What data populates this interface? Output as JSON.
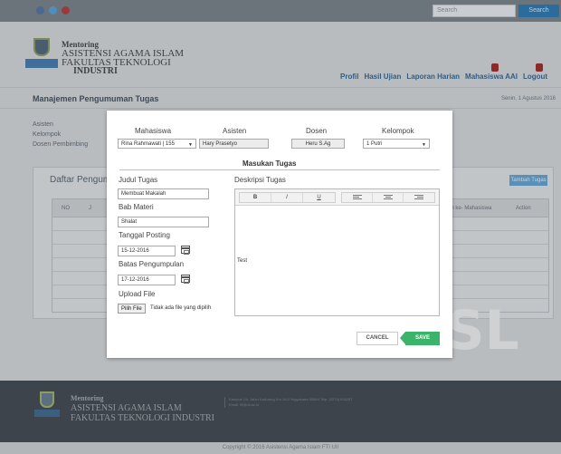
{
  "topbar": {
    "search_placeholder": "Search",
    "search_button": "Search"
  },
  "brand": {
    "line1": "Mentoring",
    "line2": "ASISTENSI AGAMA ISLAM",
    "line3": "FAKULTAS TEKNOLOGI",
    "line4": "INDUSTRI"
  },
  "nav": {
    "profil": "Profil",
    "hasil_ujian": "Hasil Ujian",
    "laporan_harian": "Laporan Harian",
    "mahasiswa_aai": "Mahasiswa AAI",
    "logout": "Logout"
  },
  "page": {
    "title": "Manajemen Pengumuman Tugas",
    "date": "Senin, 1 Agustus 2016"
  },
  "sidebar": {
    "items": [
      {
        "label": "Asisten"
      },
      {
        "label": "Kelompok"
      },
      {
        "label": "Dosen Pembimbing"
      }
    ]
  },
  "panel": {
    "title": "Daftar Pengum",
    "add_button": "Tambah Tugas",
    "columns": {
      "no": "NO",
      "col2": "J",
      "mhs": "an ke- Mahasiswa",
      "action": "Action"
    }
  },
  "modal": {
    "mahasiswa": {
      "label": "Mahasiswa",
      "value": "Rina Rahmawati | 155"
    },
    "asisten": {
      "label": "Asisten",
      "value": "Hary Prasetyo"
    },
    "dosen": {
      "label": "Dosen",
      "value": "Heru S.Ag"
    },
    "kelompok": {
      "label": "Kelompok",
      "value": "1 Putri"
    },
    "title": "Masukan Tugas",
    "judul": {
      "label": "Judul Tugas",
      "value": "Membuat Makalah"
    },
    "bab": {
      "label": "Bab Materi",
      "value": "Shalat"
    },
    "tanggal": {
      "label": "Tanggal Posting",
      "value": "15-12-2016"
    },
    "batas": {
      "label": "Batas Pengumpulan",
      "value": "17-12-2016"
    },
    "upload": {
      "label": "Upload File",
      "button": "Pilih File",
      "status": "Tidak ada file yang dipilih"
    },
    "deskripsi": {
      "label": "Deskripsi Tugas",
      "content": "Test"
    },
    "toolbar": {
      "bold": "B",
      "italic": "I",
      "underline": "U"
    },
    "cancel": "CANCEL",
    "save": "SAVE"
  },
  "footer": {
    "line1": "Mentoring",
    "line2": "ASISTENSI AGAMA ISLAM",
    "line3": "FAKULTAS TEKNOLOGI INDUSTRI",
    "address": "Kampus UII, Jalan Kaliurang Km 14,5 Yogyakarta 55584 Telp. (0274) 895287 Email: fti@uii.ac.id",
    "copyright": "Copyright © 2016 Asistensi Agama Islam FTI UII"
  },
  "colors": {
    "save_green": "#3bb36b",
    "search_blue": "#2b6c9e",
    "nav_blue": "#2f5c86"
  }
}
